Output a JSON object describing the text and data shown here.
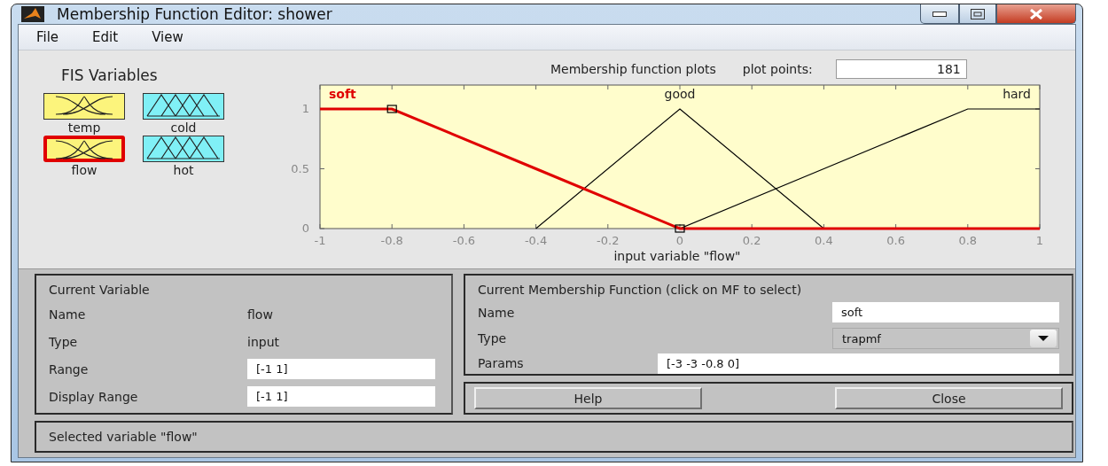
{
  "window": {
    "title": "Membership Function Editor: shower"
  },
  "menu": [
    "File",
    "Edit",
    "View"
  ],
  "fis_variables": {
    "title": "FIS Variables",
    "items": [
      {
        "name": "temp",
        "kind": "input",
        "selected": false
      },
      {
        "name": "cold",
        "kind": "output",
        "selected": false
      },
      {
        "name": "flow",
        "kind": "input",
        "selected": true
      },
      {
        "name": "hot",
        "kind": "output",
        "selected": false
      }
    ]
  },
  "plot": {
    "title": "Membership function plots",
    "plot_points_label": "plot points:",
    "plot_points": "181",
    "chart_data": {
      "type": "line",
      "xlabel": "input variable \"flow\"",
      "x": [
        -1,
        -0.8,
        -0.4,
        0,
        0.4,
        0.8,
        1
      ],
      "xlim": [
        -1,
        1
      ],
      "ylim": [
        0,
        1.2
      ],
      "xticks": [
        -1,
        -0.8,
        -0.6,
        -0.4,
        -0.2,
        0,
        0.2,
        0.4,
        0.6,
        0.8,
        1
      ],
      "yticks": [
        0,
        0.5,
        1
      ],
      "series": [
        {
          "name": "soft",
          "color": "#e00000",
          "values": [
            1,
            1,
            0.5,
            0,
            0,
            0,
            0
          ]
        },
        {
          "name": "good",
          "color": "#000000",
          "values": [
            null,
            null,
            0,
            1,
            0,
            null,
            null
          ]
        },
        {
          "name": "hard",
          "color": "#000000",
          "values": [
            null,
            null,
            null,
            0,
            0.5,
            1,
            1
          ]
        }
      ]
    },
    "curves": [
      {
        "selected": true
      },
      {
        "selected": false
      },
      {
        "selected": false
      }
    ]
  },
  "current_variable": {
    "title": "Current Variable",
    "fields": [
      {
        "label": "Name",
        "value": "flow",
        "kind": "text"
      },
      {
        "label": "Type",
        "value": "input",
        "kind": "text"
      },
      {
        "label": "Range",
        "value": "[-1 1]",
        "kind": "input"
      },
      {
        "label": "Display Range",
        "value": "[-1 1]",
        "kind": "input"
      }
    ]
  },
  "current_membership_function": {
    "title": "Current Membership Function (click on MF to select)",
    "fields": [
      {
        "label": "Name",
        "value": "soft",
        "kind": "input"
      },
      {
        "label": "Type",
        "value": "trapmf",
        "kind": "select"
      },
      {
        "label": "Params",
        "value": "[-3 -3 -0.8 0]",
        "kind": "wide"
      }
    ]
  },
  "buttons": [
    "Help",
    "Close"
  ],
  "status": "Selected variable \"flow\""
}
